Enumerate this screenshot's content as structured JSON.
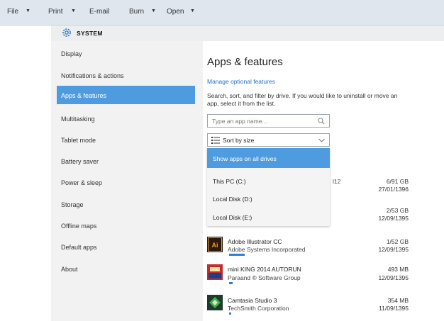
{
  "menubar": {
    "items": [
      {
        "label": "File",
        "has_caret": true
      },
      {
        "label": "Print",
        "has_caret": true
      },
      {
        "label": "E-mail",
        "has_caret": false
      },
      {
        "label": "Burn",
        "has_caret": true
      },
      {
        "label": "Open",
        "has_caret": true
      }
    ],
    "caret": "▼"
  },
  "header": {
    "title": "SYSTEM",
    "icon": "gear-icon"
  },
  "sidebar": {
    "items": [
      {
        "label": "Display"
      },
      {
        "label": "Notifications & actions"
      },
      {
        "label": "Apps & features",
        "active": true
      },
      {
        "label": "Multitasking"
      },
      {
        "label": "Tablet mode"
      },
      {
        "label": "Battery saver"
      },
      {
        "label": "Power & sleep"
      },
      {
        "label": "Storage"
      },
      {
        "label": "Offline maps"
      },
      {
        "label": "Default apps"
      },
      {
        "label": "About"
      }
    ]
  },
  "main": {
    "title": "Apps & features",
    "manage_link": "Manage optional features",
    "description": "Search, sort, and filter by drive. If you would like to uninstall or move an app, select it from the list.",
    "search": {
      "placeholder": "Type an app name..."
    },
    "sort": {
      "label": "Sort by size"
    },
    "drive_filter": {
      "options": [
        "Show apps on all drives",
        "This PC (C:)",
        "Local Disk (D:)",
        "Local Disk (E:)"
      ],
      "selected": "Show apps on all drives"
    },
    "partial_text": "l12",
    "list": [
      {
        "size": "6/91 GB",
        "date": "27/01/1396"
      },
      {
        "size": "2/53 GB",
        "date": "12/09/1395"
      },
      {
        "name": "Adobe Illustrator CC",
        "publisher": "Adobe Systems Incorporated",
        "size": "1/52 GB",
        "date": "12/09/1395",
        "icon": "adobe-illustrator-icon",
        "usage": 0.22
      },
      {
        "name": "mini KING 2014 AUTORUN",
        "publisher": "Paraand ® Software Group",
        "size": "493 MB",
        "date": "12/09/1395",
        "icon": "mini-king-icon",
        "usage": 0.05
      },
      {
        "name": "Camtasia Studio 3",
        "publisher": "TechSmith Corporation",
        "size": "354 MB",
        "date": "11/09/1395",
        "icon": "camtasia-icon",
        "usage": 0.03
      }
    ]
  },
  "colors": {
    "accent": "#4f9be0",
    "link": "#1f6fcc",
    "usage_bar": "#2f7fd8"
  }
}
